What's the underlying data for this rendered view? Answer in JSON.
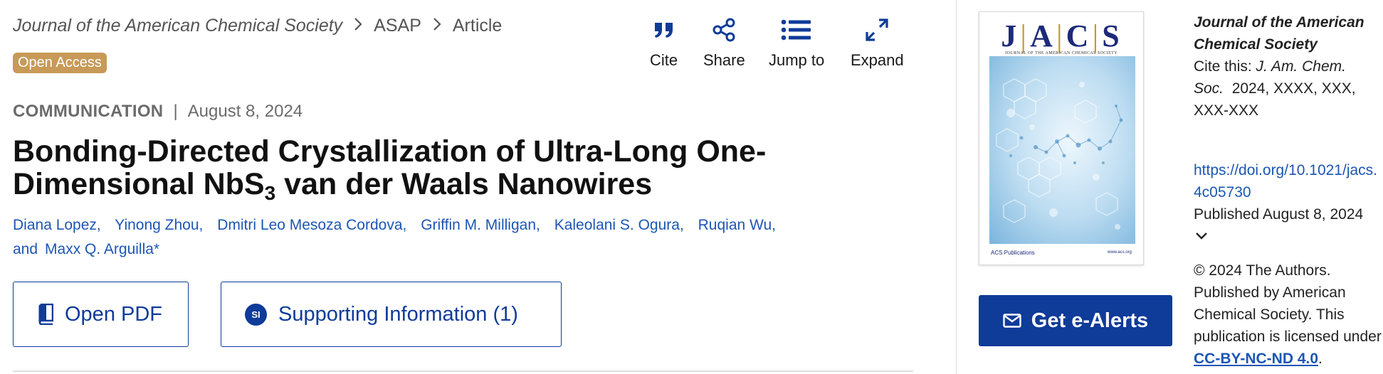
{
  "breadcrumb": {
    "journal": "Journal of the American Chemical Society",
    "section": "ASAP",
    "page": "Article"
  },
  "badge": "Open Access",
  "toolbar": {
    "cite": "Cite",
    "share": "Share",
    "jump": "Jump to",
    "expand": "Expand"
  },
  "article": {
    "type": "COMMUNICATION",
    "date": "August 8, 2024",
    "title_part1": "Bonding-Directed Crystallization of Ultra-Long One-Dimensional NbS",
    "title_sub": "3",
    "title_part2": " van der Waals Nanowires",
    "authors": [
      "Diana Lopez,",
      "Yinong Zhou,",
      "Dmitri Leo Mesoza Cordova,",
      "Griffin M. Milligan,",
      "Kaleolani S. Ogura,",
      "Ruqian Wu,"
    ],
    "and_word": "and",
    "last_author": "Maxx Q. Arguilla*"
  },
  "buttons": {
    "pdf": "Open PDF",
    "si_icon": "SI",
    "si": "Supporting Information (1)",
    "alerts": "Get e-Alerts"
  },
  "cover": {
    "logo_j": "J",
    "logo_a": "A",
    "logo_c": "C",
    "logo_s": "S",
    "subtitle": "JOURNAL OF THE AMERICAN CHEMICAL SOCIETY",
    "publisher": "ACS Publications",
    "site": "www.acs.org"
  },
  "info": {
    "journal": "Journal of the American Chemical Society",
    "cite_label": "Cite this:",
    "cite_abbr": "J. Am. Chem. Soc.",
    "cite_rest": "2024, XXXX, XXX, XXX-XXX",
    "doi": "https://doi.org/10.1021/jacs.4c05730",
    "published": "Published August 8, 2024",
    "copyright": "© 2024 The Authors. Published by American Chemical Society. This publication is licensed under",
    "license": "CC-BY-NC-ND 4.0",
    "period": "."
  },
  "colors": {
    "brand_blue": "#0f3b99",
    "link_blue": "#1d56b3",
    "badge_gold": "#c89a57"
  }
}
